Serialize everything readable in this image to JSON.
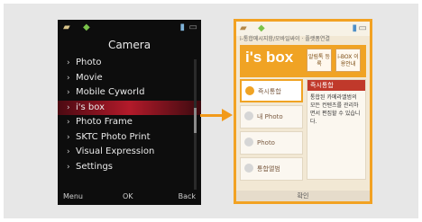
{
  "left_screen": {
    "title": "Camera",
    "menu_items": [
      "Photo",
      "Movie",
      "Mobile Cyworld",
      "i's box",
      "Photo Frame",
      "SKTC Photo Print",
      "Visual Expression",
      "Settings"
    ],
    "softkeys": {
      "left": "Menu",
      "center": "OK",
      "right": "Back"
    }
  },
  "right_screen": {
    "strip_text": "i-통합메시지함/모바일싸이 · 플랫폼연결",
    "brand": "i's box",
    "buttons": [
      "알림톡\n등록",
      "i-BOX\n이용안내"
    ],
    "items": [
      "즉시통합",
      "내 Photo",
      "Photo",
      "통합앨범"
    ],
    "info_title": "즉시통합",
    "info_text": "통합된 카메라앨범의 모든 컨텐츠를 관리하면서 편집할 수 있습니다.",
    "softkey": "확인"
  },
  "accent": "#f29a1a"
}
